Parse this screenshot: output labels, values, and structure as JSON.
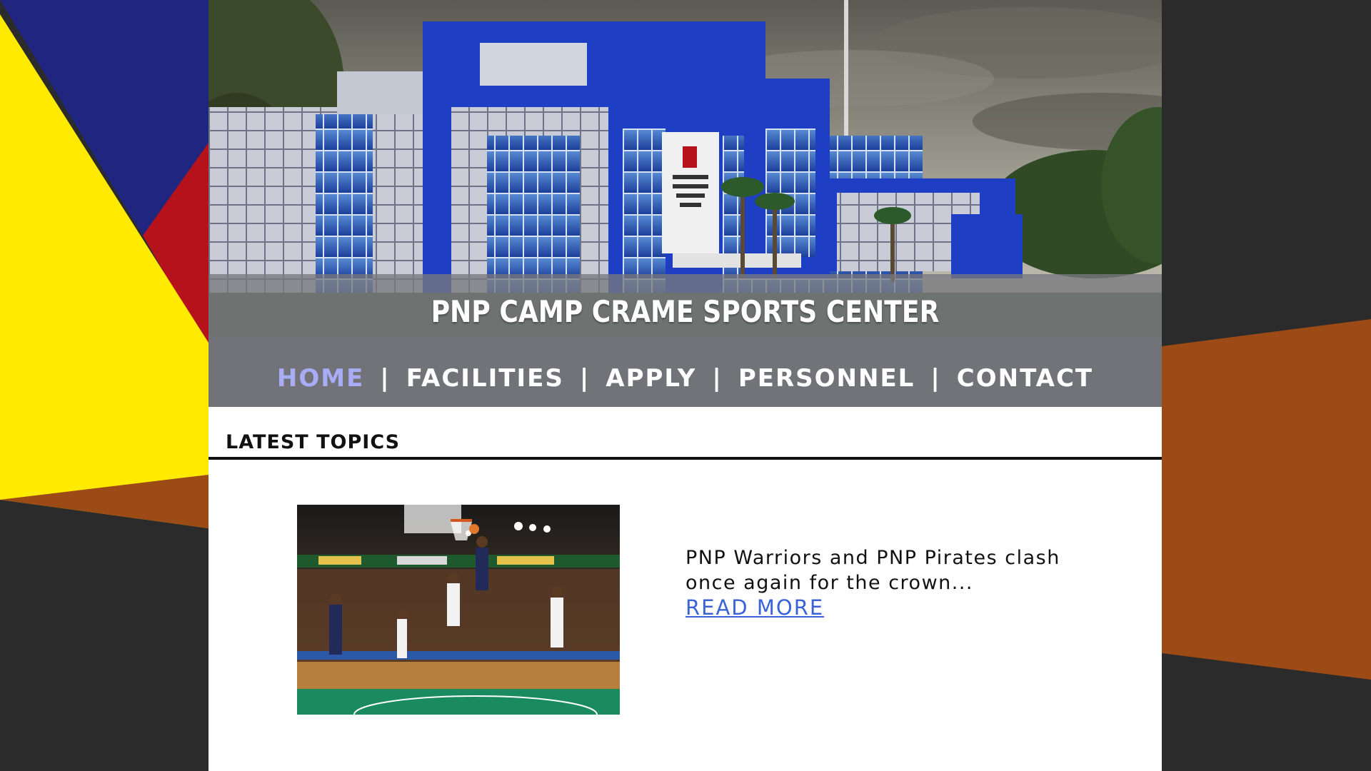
{
  "site": {
    "title": "PNP CAMP CRAME SPORTS CENTER"
  },
  "nav": {
    "items": [
      {
        "label": "HOME",
        "active": true
      },
      {
        "label": "FACILITIES",
        "active": false
      },
      {
        "label": "APPLY",
        "active": false
      },
      {
        "label": "PERSONNEL",
        "active": false
      },
      {
        "label": "CONTACT",
        "active": false
      }
    ],
    "separator": "|"
  },
  "latest": {
    "heading": "LATEST TOPICS",
    "topic": {
      "summary": "PNP Warriors and PNP Pirates clash once again for the crown...",
      "read_more": "READ MORE"
    }
  },
  "colors": {
    "nav_active": "#a7acf5",
    "link": "#3a63d9",
    "bg_yellow": "#ffea00",
    "bg_blue": "#20257f",
    "bg_red": "#b5121b",
    "bg_orange": "#9c4a16",
    "bg_dark": "#2b2b2b"
  }
}
